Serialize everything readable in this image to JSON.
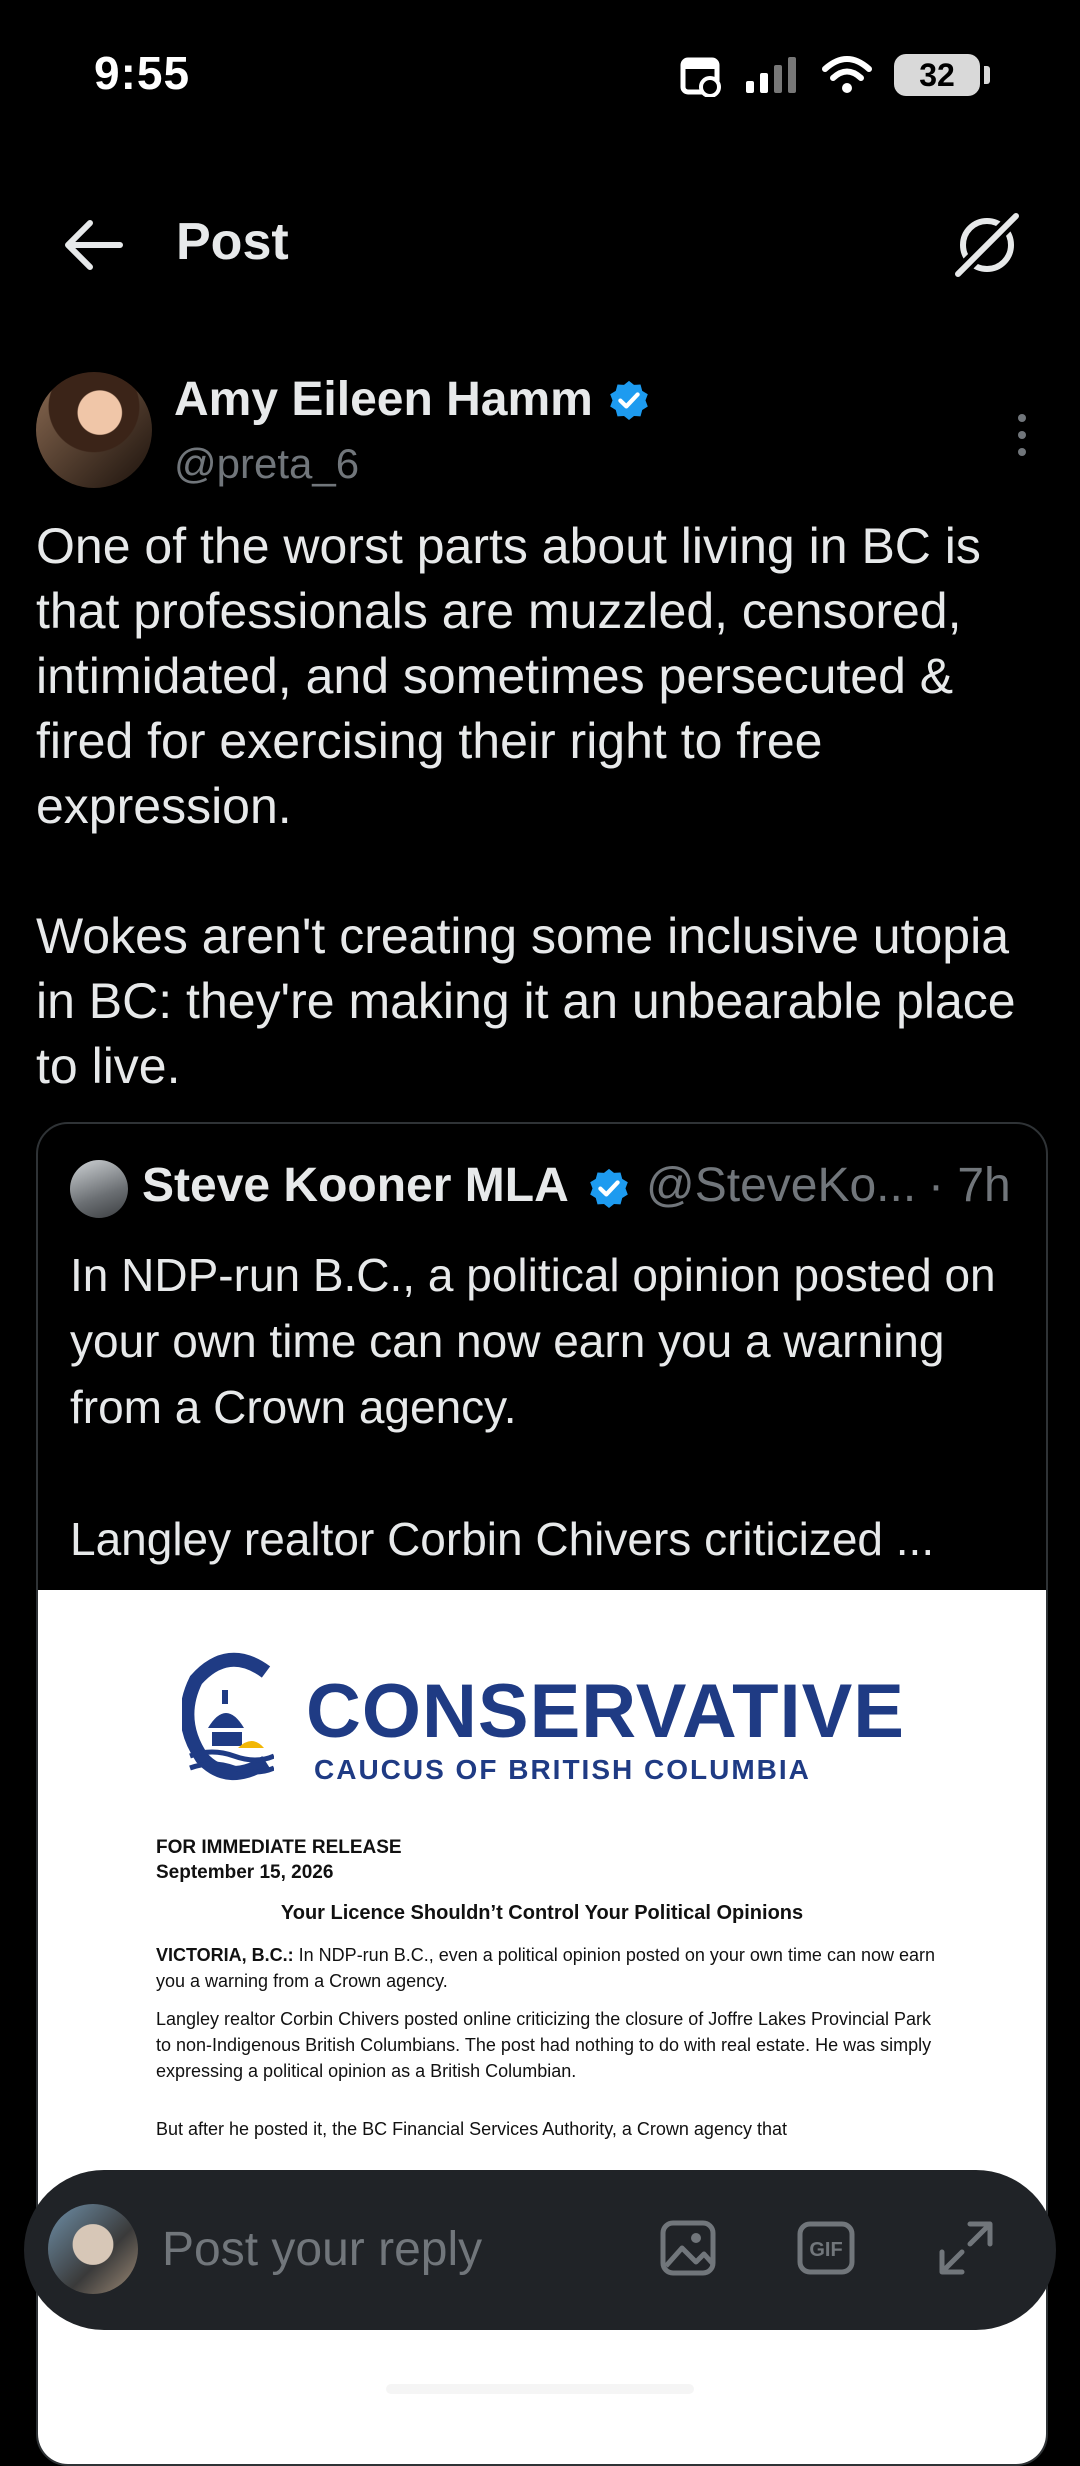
{
  "status": {
    "time": "9:55",
    "battery": "32"
  },
  "header": {
    "title": "Post"
  },
  "post": {
    "author_name": "Amy Eileen Hamm",
    "author_handle": "@preta_6",
    "text": "One of the worst parts about living in BC is that professionals are muzzled, censored, intimidated, and sometimes persecuted & fired for exercising their right to free expression.\n\nWokes aren't creating some inclusive utopia in BC: they're making it an unbearable place to live."
  },
  "quote": {
    "author_name": "Steve Kooner MLA",
    "author_handle": "@SteveKo...",
    "time": "· 7h",
    "text": "In NDP-run B.C., a political opinion posted on your own time can now earn you a warning from a Crown agency.\n\nLangley realtor Corbin Chivers criticized ...",
    "image": {
      "logo_title": "CONSERVATIVE",
      "logo_subtitle": "CAUCUS OF BRITISH COLUMBIA",
      "release_label": "FOR IMMEDIATE RELEASE",
      "release_date": "September 15, 2026",
      "headline": "Your Licence Shouldn’t Control Your Political Opinions",
      "para1_lead": "VICTORIA, B.C.:",
      "para1": " In NDP-run B.C., even a political opinion posted on your own time can now earn you a warning from a Crown agency.",
      "para2": "Langley realtor Corbin Chivers posted online criticizing the closure of Joffre Lakes Provincial Park to non-Indigenous British Columbians. The post had nothing to do with real estate. He was simply expressing a political opinion as a British Columbian.",
      "para3": "But after he posted it, the BC Financial Services Authority, a Crown agency that"
    }
  },
  "reply": {
    "placeholder": "Post your reply"
  },
  "icons": [
    "back-arrow-icon",
    "grok-icon",
    "verified-badge-icon",
    "more-icon",
    "image-icon",
    "gif-icon",
    "expand-icon"
  ],
  "colors": {
    "verified": "#1d9bf0",
    "background": "#000000",
    "secondary_text": "#71767b",
    "conservative_blue": "#1f3b84"
  }
}
